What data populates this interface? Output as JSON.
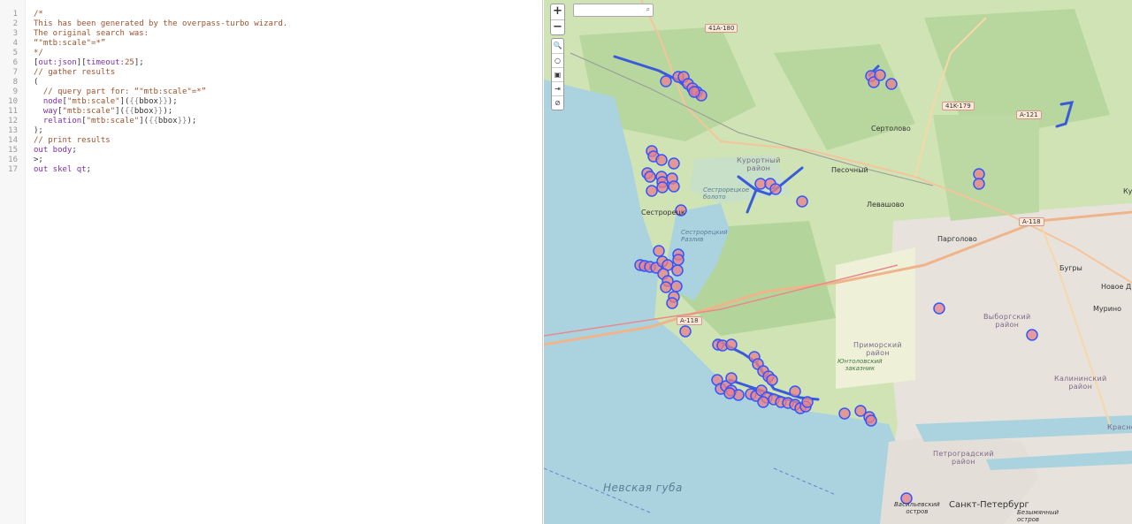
{
  "editor": {
    "lines": [
      {
        "n": "1",
        "segs": [
          [
            "c-comment",
            "/*"
          ]
        ]
      },
      {
        "n": "2",
        "segs": [
          [
            "c-comment",
            "This has been generated by the overpass-turbo wizard."
          ]
        ]
      },
      {
        "n": "3",
        "segs": [
          [
            "c-comment",
            "The original search was:"
          ]
        ]
      },
      {
        "n": "4",
        "segs": [
          [
            "c-comment",
            "“\"mtb:scale\"=*”"
          ]
        ]
      },
      {
        "n": "5",
        "segs": [
          [
            "c-comment",
            "*/"
          ]
        ]
      },
      {
        "n": "6",
        "segs": [
          [
            "tx",
            "["
          ],
          [
            "c-kw",
            "out:json"
          ],
          [
            "tx",
            "]["
          ],
          [
            "c-kw",
            "timeout:"
          ],
          [
            "c-num",
            "25"
          ],
          [
            "tx",
            "];"
          ]
        ]
      },
      {
        "n": "7",
        "segs": [
          [
            "c-comment",
            "// gather results"
          ]
        ]
      },
      {
        "n": "8",
        "segs": [
          [
            "tx",
            "("
          ]
        ]
      },
      {
        "n": "9",
        "segs": [
          [
            "c-comment",
            "  // query part for: “\"mtb:scale\"=*”"
          ]
        ]
      },
      {
        "n": "10",
        "segs": [
          [
            "tx",
            "  "
          ],
          [
            "c-kw",
            "node"
          ],
          [
            "tx",
            "["
          ],
          [
            "c-str",
            "\"mtb:scale\""
          ],
          [
            "tx",
            "]("
          ],
          [
            "c-bb",
            "{{"
          ],
          [
            "tx",
            "bbox"
          ],
          [
            "c-bb",
            "}}"
          ],
          [
            "tx",
            ");"
          ]
        ]
      },
      {
        "n": "11",
        "segs": [
          [
            "tx",
            "  "
          ],
          [
            "c-kw",
            "way"
          ],
          [
            "tx",
            "["
          ],
          [
            "c-str",
            "\"mtb:scale\""
          ],
          [
            "tx",
            "]("
          ],
          [
            "c-bb",
            "{{"
          ],
          [
            "tx",
            "bbox"
          ],
          [
            "c-bb",
            "}}"
          ],
          [
            "tx",
            ");"
          ]
        ]
      },
      {
        "n": "12",
        "segs": [
          [
            "tx",
            "  "
          ],
          [
            "c-kw",
            "relation"
          ],
          [
            "tx",
            "["
          ],
          [
            "c-str",
            "\"mtb:scale\""
          ],
          [
            "tx",
            "]("
          ],
          [
            "c-bb",
            "{{"
          ],
          [
            "tx",
            "bbox"
          ],
          [
            "c-bb",
            "}}"
          ],
          [
            "tx",
            ");"
          ]
        ]
      },
      {
        "n": "13",
        "segs": [
          [
            "tx",
            ");"
          ]
        ]
      },
      {
        "n": "14",
        "segs": [
          [
            "c-comment",
            "// print results"
          ]
        ]
      },
      {
        "n": "15",
        "segs": [
          [
            "c-kw",
            "out body"
          ],
          [
            "tx",
            ";"
          ]
        ]
      },
      {
        "n": "16",
        "segs": [
          [
            "tx",
            ">;"
          ]
        ]
      },
      {
        "n": "17",
        "segs": [
          [
            "c-kw",
            "out skel qt"
          ],
          [
            "tx",
            ";"
          ]
        ]
      }
    ]
  },
  "map": {
    "zoom_in": "+",
    "zoom_out": "−",
    "search_icon": "search-icon",
    "tools": [
      "🔍",
      "○",
      "▣",
      "⇥",
      "⊘"
    ],
    "labels": {
      "kurortny": "Курортный\nрайон",
      "pesochny": "Песочный",
      "sertolovo": "Сертолово",
      "levashovo": "Левашово",
      "sestroretsk": "Сестрорецк",
      "sestr_boloto": "Сестрорецкое\nболото",
      "sestr_razliv": "Сестрорецкий\nРазлив",
      "pargolovo": "Парголово",
      "bugry": "Бугры",
      "novoe": "Новое Д",
      "murino": "Мурино",
      "vyborgsky": "Выборгский\nрайон",
      "primorsky": "Приморский\nрайон",
      "yuntolovsky": "Юнтоловский\nзаказник",
      "kalininsky": "Калининский\nрайон",
      "petrogradsky": "Петроградский\nрайон",
      "krasno": "Красно",
      "nevskaya": "Невская губа",
      "vasilyevsky": "Васильевский\nостров",
      "spb": "Санкт-Петербург",
      "bezymyanny": "Безымянный\nостров",
      "ku": "Ку"
    },
    "roads": {
      "r1": "41A-180",
      "r2": "41K-179",
      "r3": "A-121",
      "r4": "A-118",
      "r5": "A-118"
    },
    "colors": {
      "water": "#aad3df",
      "forest": "#add19e",
      "land": "#f2efe9",
      "marker_fill": "#e8808a",
      "marker_stroke": "#3355ff",
      "route": "#3a5bd9"
    }
  }
}
